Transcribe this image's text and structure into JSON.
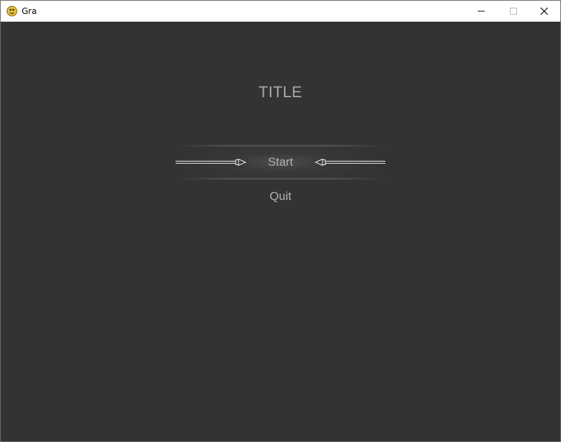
{
  "window": {
    "title": "Gra",
    "icon": "python-snake-icon",
    "controls": [
      "minimize-icon",
      "maximize-icon",
      "close-icon"
    ]
  },
  "game": {
    "title": "TITLE",
    "menu": [
      {
        "label": "Start",
        "selected": true
      },
      {
        "label": "Quit",
        "selected": false
      }
    ]
  },
  "colors": {
    "background": "#333333",
    "text": "#b2b2b2",
    "titlebar": "#ffffff"
  }
}
